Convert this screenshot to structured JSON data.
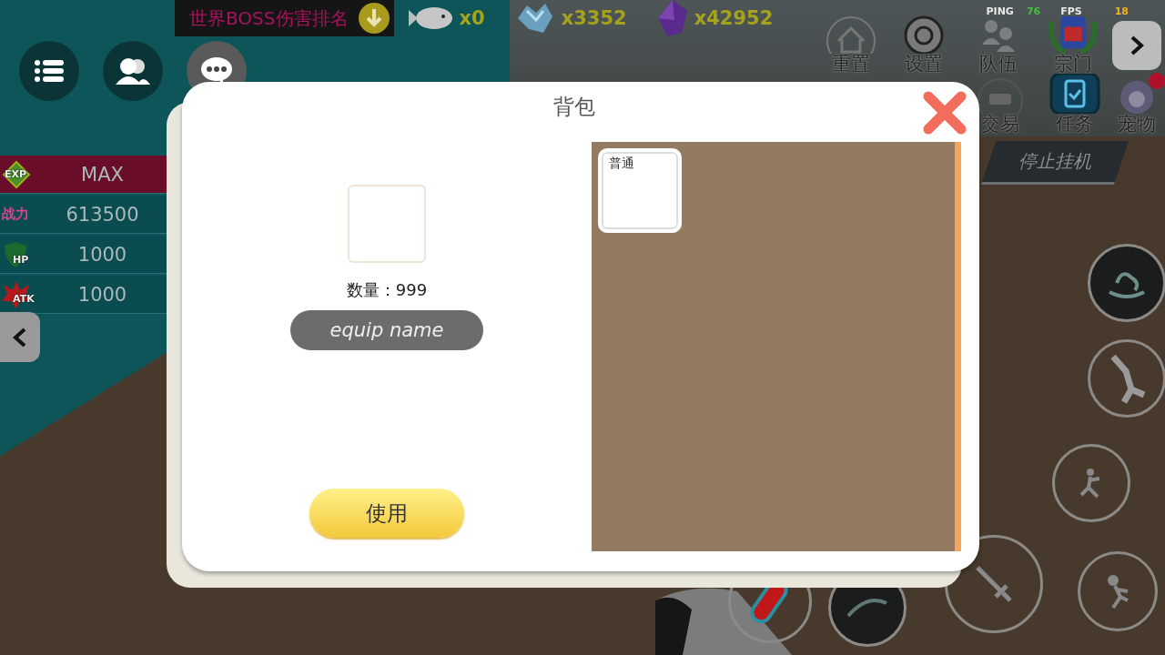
{
  "top_bar": {
    "boss_rank": "世界BOSS伤害排名",
    "currencies": [
      {
        "kind": "fish",
        "amount": "x0"
      },
      {
        "kind": "crystal",
        "amount": "x3352"
      },
      {
        "kind": "gem",
        "amount": "x42952"
      }
    ]
  },
  "net": {
    "ping_label": "PING",
    "ping": "76",
    "fps_label": "FPS",
    "fps": "18"
  },
  "menu_row1": [
    {
      "kind": "home",
      "label": "重置"
    },
    {
      "kind": "gear",
      "label": "设置"
    },
    {
      "kind": "team",
      "label": "队伍"
    },
    {
      "kind": "emblem",
      "label": "宗门"
    }
  ],
  "menu_row2": [
    {
      "kind": "cart",
      "label": "交易",
      "alert": false
    },
    {
      "kind": "task",
      "label": "任务",
      "alert": false
    },
    {
      "kind": "pet",
      "label": "宠物",
      "alert": true
    }
  ],
  "idle_button": "停止挂机",
  "stats": [
    {
      "kind": "exp",
      "label": "EXP",
      "value": "MAX"
    },
    {
      "kind": "power",
      "label": "战力",
      "value": "613500"
    },
    {
      "kind": "hp",
      "label": "HP",
      "value": "1000"
    },
    {
      "kind": "atk",
      "label": "ATK",
      "value": "1000"
    }
  ],
  "dialog": {
    "title": "背包",
    "item": {
      "quantity": "数量：999",
      "name": "equip name"
    },
    "use_button": "使用",
    "inventory": [
      {
        "label": "普通",
        "selected": false
      }
    ]
  }
}
